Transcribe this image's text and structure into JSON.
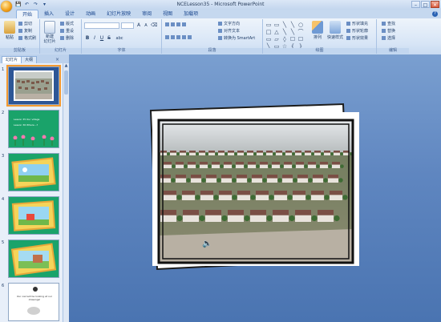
{
  "window": {
    "title": "NCELesson35 - Microsoft PowerPoint",
    "controls": [
      "–",
      "□",
      "✕"
    ]
  },
  "quick_access": [
    "💾",
    "↶",
    "↷",
    "▾"
  ],
  "tabs": [
    "开始",
    "插入",
    "设计",
    "动画",
    "幻灯片放映",
    "审阅",
    "视图",
    "加载项"
  ],
  "ribbon": {
    "clipboard": {
      "label": "剪贴板",
      "paste": "粘贴",
      "cut": "剪切",
      "copy": "复制",
      "format_painter": "格式刷"
    },
    "slides": {
      "label": "幻灯片",
      "new_slide": "新建\n幻灯片",
      "layout": "版式",
      "reset": "重设",
      "delete": "删除"
    },
    "font": {
      "label": "字体",
      "name": "",
      "size": "",
      "grow": "A",
      "shrink": "A",
      "clear": "⌫",
      "bold": "B",
      "italic": "I",
      "underline": "U",
      "strike": "S",
      "shadow": "abc"
    },
    "paragraph": {
      "label": "段落",
      "text_direction": "文字方向",
      "align_text": "对齐文本",
      "smartart": "转换为 SmartArt"
    },
    "drawing": {
      "label": "绘图",
      "arrange": "排列",
      "quick_styles": "快速样式",
      "fill": "形状填充",
      "outline": "形状轮廓",
      "effects": "形状效果"
    },
    "editing": {
      "label": "编辑",
      "find": "查找",
      "replace": "替换",
      "select": "选择"
    },
    "shapes": [
      "▭",
      "▭",
      "╲",
      "╲",
      "○",
      "□",
      "△",
      "╲",
      "╲",
      "⌒",
      "▭",
      "▱",
      "◊",
      "☐",
      "☐",
      "╲",
      "▭",
      "☆",
      "{",
      "}"
    ]
  },
  "panel": {
    "tab_slides": "幻灯片",
    "tab_outline": "大纲",
    "close": "×",
    "slides": [
      {
        "num": "1",
        "selected": true
      },
      {
        "num": "2",
        "text1": "Lesson 35  Our village",
        "text2": "Lesson 36  Where...?"
      },
      {
        "num": "3"
      },
      {
        "num": "4"
      },
      {
        "num": "5"
      },
      {
        "num": "6",
        "text1": "Our owl will be looking at our drawings!"
      }
    ]
  },
  "scroll": {
    "up": "▲",
    "down": "▼"
  },
  "colors": {
    "ribbon_bg": "#d7e5f6",
    "editor_bg": "#5f86c0",
    "thumb_green": "#1aa36a",
    "selection": "#f39a32"
  },
  "speaker": "🔈"
}
